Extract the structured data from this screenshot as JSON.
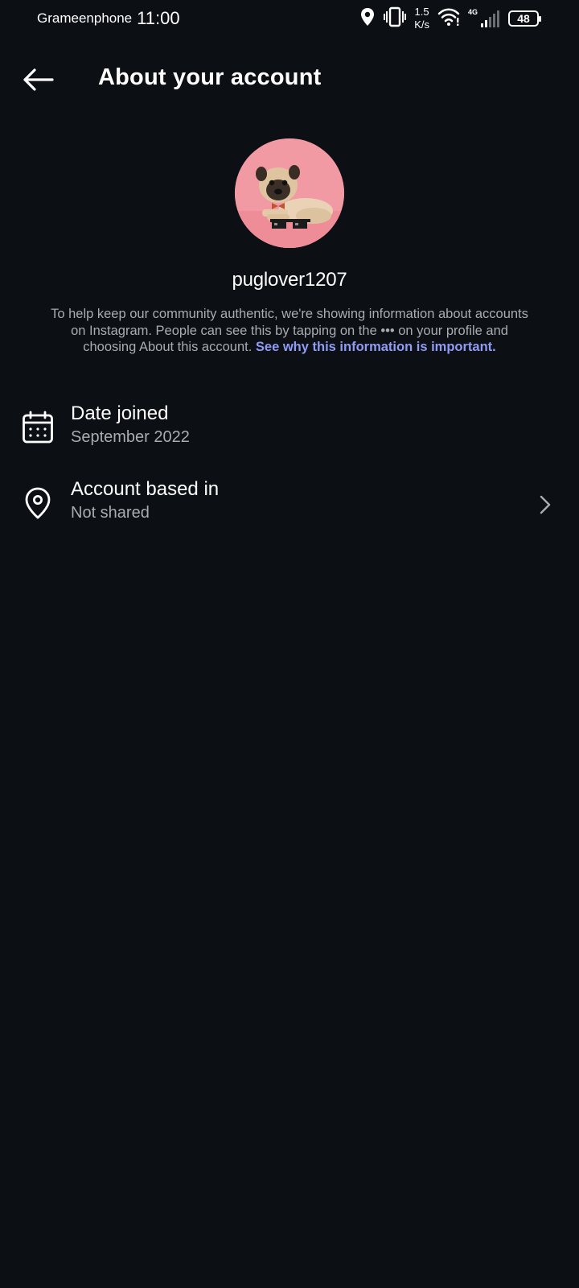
{
  "status_bar": {
    "carrier": "Grameenphone",
    "time": "11:00",
    "speed_value": "1.5",
    "speed_unit": "K/s",
    "network_type": "4G",
    "battery": "48"
  },
  "header": {
    "title": "About your account"
  },
  "profile": {
    "username": "puglover1207",
    "info_text": "To help keep our community authentic, we're showing information about accounts on Instagram. People can see this by tapping on the ••• on your profile and choosing About this account.",
    "info_link": "See why this information is important."
  },
  "rows": [
    {
      "title": "Date joined",
      "value": "September 2022"
    },
    {
      "title": "Account based in",
      "value": "Not shared"
    }
  ],
  "colors": {
    "background": "#0c0f14",
    "secondary_text": "#a8acb3",
    "link": "#8f9cf5",
    "avatar_bg": "#f29aa3"
  }
}
